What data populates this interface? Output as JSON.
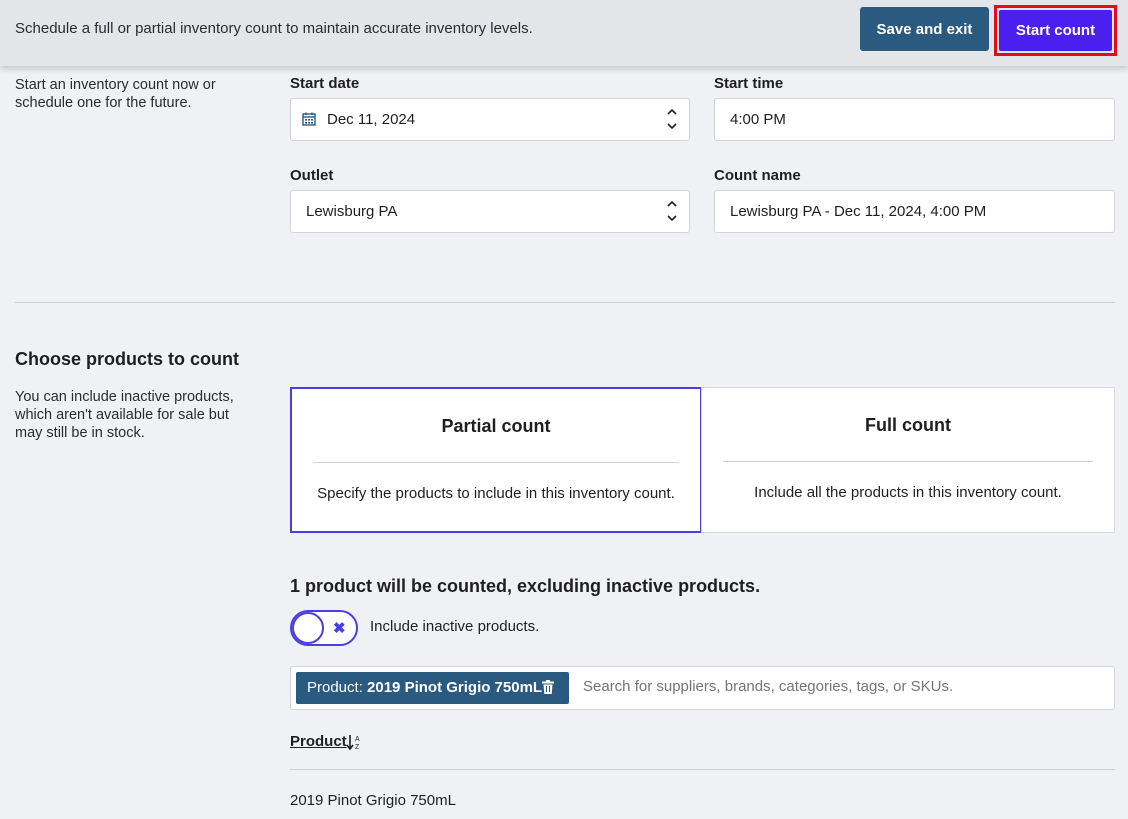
{
  "header": {
    "description": "Schedule a full or partial inventory count to maintain accurate inventory levels.",
    "save_label": "Save and exit",
    "start_label": "Start count"
  },
  "schedule": {
    "side_text_1": "Start an inventory count now or",
    "side_text_2": "schedule one for the future.",
    "start_date_label": "Start date",
    "start_date_value": "Dec 11, 2024",
    "start_time_label": "Start time",
    "start_time_value": "4:00 PM",
    "outlet_label": "Outlet",
    "outlet_value": "Lewisburg PA",
    "count_name_label": "Count name",
    "count_name_value": "Lewisburg PA - Dec 11, 2024, 4:00 PM"
  },
  "products": {
    "heading": "Choose products to count",
    "side_text_1": "You can include inactive products,",
    "side_text_2": "which aren't available for sale but",
    "side_text_3": "may still be in stock.",
    "partial_title": "Partial count",
    "partial_desc": "Specify the products to include in this inventory count.",
    "full_title": "Full count",
    "full_desc": "Include all the products in this inventory count.",
    "summary": "1 product will be counted, excluding inactive products.",
    "toggle_label": "Include inactive products.",
    "chip_prefix": "Product: ",
    "chip_value": "2019 Pinot Grigio 750mL",
    "search_placeholder": "Search for suppliers, brands, categories, tags, or SKUs.",
    "column_header": "Product",
    "rows": [
      "2019 Pinot Grigio 750mL"
    ]
  },
  "colors": {
    "accent": "#4b3ee0",
    "primary_button": "#4b1ff0",
    "secondary_button": "#2a5a80",
    "highlight_border": "#e00e1a"
  },
  "icons": [
    "calendar-icon",
    "stepper-arrows-icon",
    "close-icon",
    "trash-icon",
    "sort-az-icon"
  ]
}
